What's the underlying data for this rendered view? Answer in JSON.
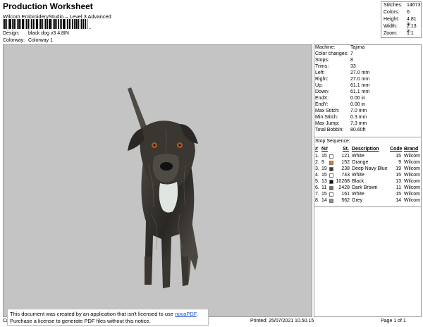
{
  "header": {
    "title": "Production Worksheet",
    "subtitle": "Wilcom EmbroideryStudio – Level 3 Advanced",
    "barcode_suffix": ",",
    "design_key": "Design:",
    "design_value": "black dog v3 4,8IN",
    "colorway_key": "Colorway:",
    "colorway_value": "Colorway 1"
  },
  "stats": [
    {
      "k": "Stitches:",
      "v": "14673"
    },
    {
      "k": "Colors:",
      "v": "6"
    },
    {
      "k": "Height:",
      "v": "4.81 in"
    },
    {
      "k": "Width:",
      "v": "2.13 in"
    },
    {
      "k": "Zoom:",
      "v": "1:1"
    }
  ],
  "machine": [
    {
      "k": "Machine:",
      "v": "Tajima"
    },
    {
      "k": "Color changes:",
      "v": "7"
    },
    {
      "k": "Stops:",
      "v": "8"
    },
    {
      "k": "Trims:",
      "v": "33"
    },
    {
      "k": "Left:",
      "v": "27.0 mm"
    },
    {
      "k": "Right:",
      "v": "27.0 mm"
    },
    {
      "k": "Up:",
      "v": "61.1 mm"
    },
    {
      "k": "Down:",
      "v": "61.1 mm"
    },
    {
      "k": "EndX:",
      "v": "0.00 in"
    },
    {
      "k": "EndY:",
      "v": "0.00 in"
    },
    {
      "k": "Max Stitch:",
      "v": "7.0 mm"
    },
    {
      "k": "Min Stitch:",
      "v": "0.3 mm"
    },
    {
      "k": "Max Jump:",
      "v": "7.3 mm"
    },
    {
      "k": "Total Bobbin:",
      "v": "80.60ft"
    }
  ],
  "stop_sequence": {
    "title": "Stop Sequence:",
    "headers": [
      "#",
      "N#",
      "St.",
      "Description",
      "Code",
      "Brand"
    ],
    "rows": [
      {
        "idx": "1.",
        "n": "15",
        "color": "#ffffff",
        "st": "121",
        "desc": "White",
        "code": "15",
        "brand": "Wilcom"
      },
      {
        "idx": "2.",
        "n": "9",
        "color": "#e8761a",
        "st": "152",
        "desc": "Orange",
        "code": "9",
        "brand": "Wilcom"
      },
      {
        "idx": "3.",
        "n": "19",
        "color": "#3a3a40",
        "st": "238",
        "desc": "Deep Navy Blue",
        "code": "19",
        "brand": "Wilcom"
      },
      {
        "idx": "4.",
        "n": "15",
        "color": "#ffffff",
        "st": "743",
        "desc": "White",
        "code": "15",
        "brand": "Wilcom"
      },
      {
        "idx": "5.",
        "n": "13",
        "color": "#111111",
        "st": "10268",
        "desc": "Black",
        "code": "13",
        "brand": "Wilcom"
      },
      {
        "idx": "6.",
        "n": "11",
        "color": "#8a6a55",
        "st": "2428",
        "desc": "Dark Brown",
        "code": "11",
        "brand": "Wilcom"
      },
      {
        "idx": "7.",
        "n": "15",
        "color": "#ffffff",
        "st": "161",
        "desc": "White",
        "code": "15",
        "brand": "Wilcom"
      },
      {
        "idx": "8.",
        "n": "14",
        "color": "#8c8c8c",
        "st": "562",
        "desc": "Grey",
        "code": "14",
        "brand": "Wilcom"
      }
    ]
  },
  "footer": {
    "left": "Cr",
    "printed": "Printed: 25/07/2021 10.50.15",
    "page": "Page 1 of 1"
  },
  "notice": {
    "line1_prefix": "This document was created by an application that isn't licensed to use ",
    "link": "novaPDF",
    "line1_suffix": ".",
    "line2": "Purchase a license to generate PDF files without this notice."
  }
}
